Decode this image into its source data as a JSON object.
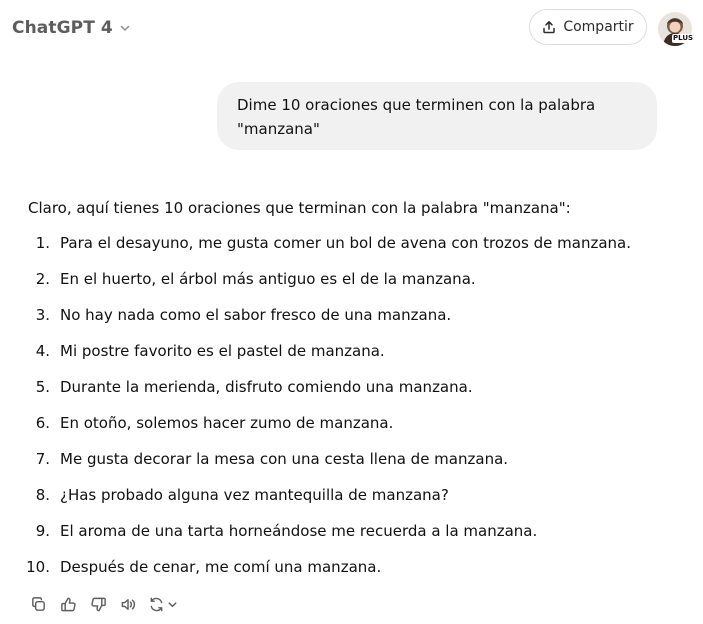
{
  "header": {
    "model_name": "ChatGPT 4",
    "share_label": "Compartir",
    "plan_badge": "PLUS"
  },
  "user_message": "Dime 10 oraciones que terminen con la palabra\n\"manzana\"",
  "assistant": {
    "intro": "Claro, aquí tienes 10 oraciones que terminan con la palabra \"manzana\":",
    "items": [
      {
        "num": "1.",
        "text": "Para el desayuno, me gusta comer un bol de avena con trozos de manzana."
      },
      {
        "num": "2.",
        "text": "En el huerto, el árbol más antiguo es el de la manzana."
      },
      {
        "num": "3.",
        "text": "No hay nada como el sabor fresco de una manzana."
      },
      {
        "num": "4.",
        "text": "Mi postre favorito es el pastel de manzana."
      },
      {
        "num": "5.",
        "text": "Durante la merienda, disfruto comiendo una manzana."
      },
      {
        "num": "6.",
        "text": "En otoño, solemos hacer zumo de manzana."
      },
      {
        "num": "7.",
        "text": "Me gusta decorar la mesa con una cesta llena de manzana."
      },
      {
        "num": "8.",
        "text": "¿Has probado alguna vez mantequilla de manzana?"
      },
      {
        "num": "9.",
        "text": "El aroma de una tarta horneándose me recuerda a la manzana."
      },
      {
        "num": "10.",
        "text": "Después de cenar, me comí una manzana."
      }
    ]
  },
  "action_icons": [
    "copy-icon",
    "thumbs-up-icon",
    "thumbs-down-icon",
    "read-aloud-icon",
    "regenerate-icon",
    "chevron-down-icon"
  ],
  "colors": {
    "accent_text": "#5d5d5d",
    "user_bubble": "#f1f1f1",
    "border": "#dcdcdc",
    "icon": "#5d5d5d"
  }
}
